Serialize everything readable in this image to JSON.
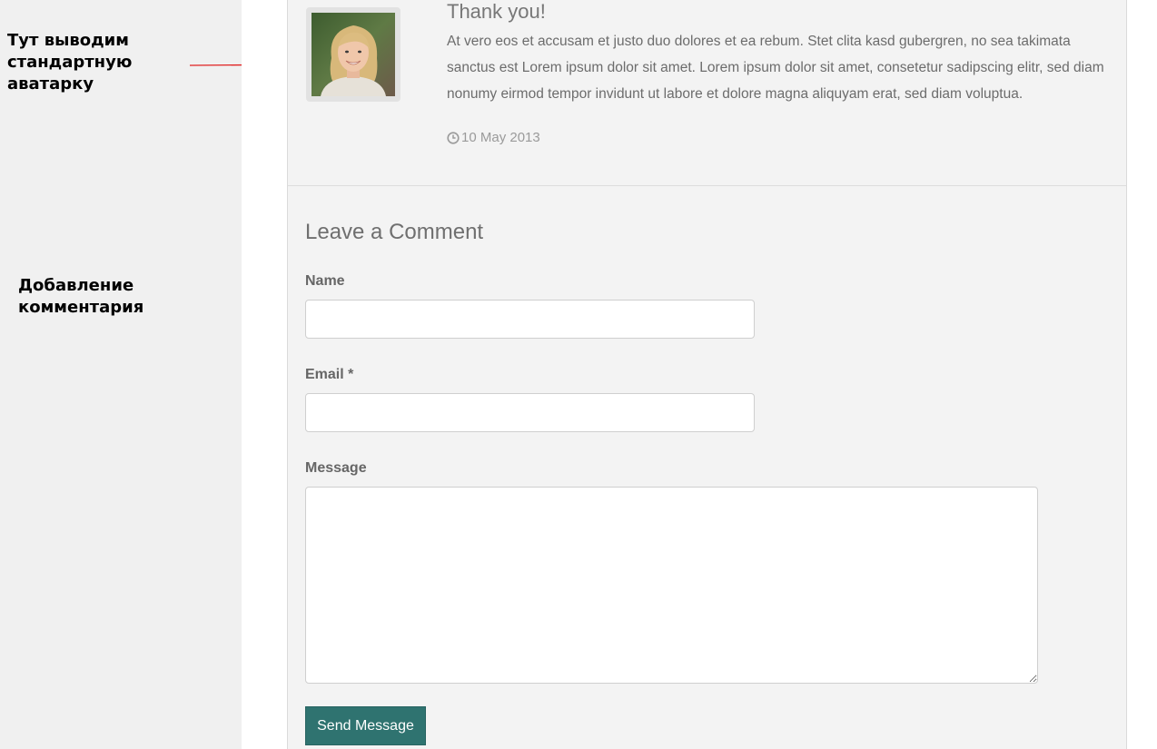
{
  "annotations": {
    "avatar_note": "Тут выводим\nстандартную\nаватарку",
    "comment_note": "Добавление\nкомментария",
    "arrow_color": "#e02020"
  },
  "comment": {
    "title": "Thank you!",
    "body": "At vero eos et accusam et justo duo dolores et ea rebum. Stet clita kasd gubergren, no sea takimata sanctus est Lorem ipsum dolor sit amet. Lorem ipsum dolor sit amet, consetetur sadipscing elitr, sed diam nonumy eirmod tempor invidunt ut labore et dolore magna aliquyam erat, sed diam voluptua.",
    "date": "10 May 2013",
    "date_icon": "clock-icon",
    "avatar_icon": "user-avatar-photo"
  },
  "form": {
    "title": "Leave a Comment",
    "name_label": "Name",
    "name_value": "",
    "email_label": "Email *",
    "email_value": "",
    "message_label": "Message",
    "message_value": "",
    "submit_label": "Send Message"
  },
  "colors": {
    "accent": "#2f7370",
    "panel": "#f3f3f3",
    "page_bg": "#f0f0f0"
  }
}
